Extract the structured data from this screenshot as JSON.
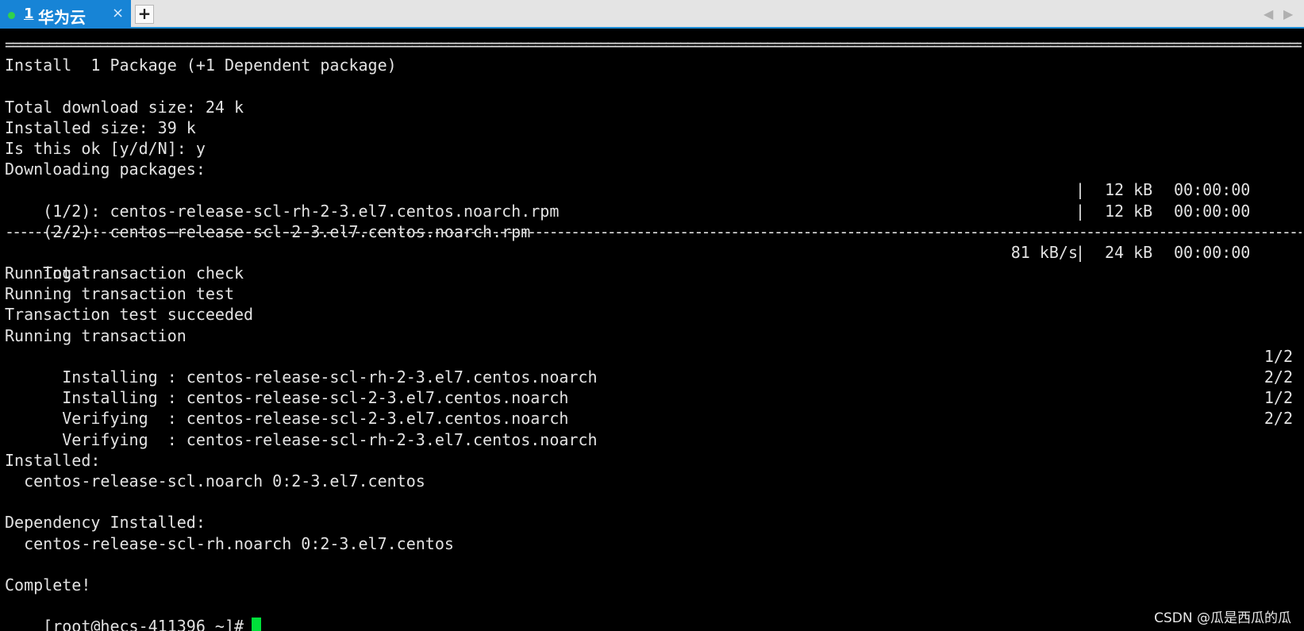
{
  "tab": {
    "number": "1",
    "title": "华为云",
    "close": "×",
    "status_color": "#31d14d",
    "accent_color": "#1784d6"
  },
  "tabbar": {
    "new_tab": "+",
    "nav_left": "◀",
    "nav_right": "▶"
  },
  "terminal": {
    "rule_eq": "============================================================================================================================================================================================================",
    "rule_dash": "--------------------------------------------------------------------------------------------------------------------------------------------------------------------------------------------------------------",
    "install_summary": "Install  1 Package (+1 Dependent package)",
    "total_download": "Total download size: 24 k",
    "installed_size": "Installed size: 39 k",
    "confirm": "Is this ok [y/d/N]: y",
    "downloading": "Downloading packages:",
    "downloads": [
      {
        "name": "(1/2): centos-release-scl-rh-2-3.el7.centos.noarch.rpm",
        "pipe": "|",
        "size": "12 kB",
        "time": "00:00:00"
      },
      {
        "name": "(2/2): centos-release-scl-2-3.el7.centos.noarch.rpm",
        "pipe": "|",
        "size": "12 kB",
        "time": "00:00:00"
      }
    ],
    "total": {
      "label": "Total",
      "rate": "81 kB/s",
      "pipe": "|",
      "size": "24 kB",
      "time": "00:00:00"
    },
    "check": "Running transaction check",
    "test": "Running transaction test",
    "succeeded": "Transaction test succeeded",
    "running": "Running transaction",
    "steps": [
      {
        "text": "  Installing : centos-release-scl-rh-2-3.el7.centos.noarch",
        "count": "1/2"
      },
      {
        "text": "  Installing : centos-release-scl-2-3.el7.centos.noarch",
        "count": "2/2"
      },
      {
        "text": "  Verifying  : centos-release-scl-2-3.el7.centos.noarch",
        "count": "1/2"
      },
      {
        "text": "  Verifying  : centos-release-scl-rh-2-3.el7.centos.noarch",
        "count": "2/2"
      }
    ],
    "installed_header": "Installed:",
    "installed_pkg": "  centos-release-scl.noarch 0:2-3.el7.centos",
    "dep_header": "Dependency Installed:",
    "dep_pkg": "  centos-release-scl-rh.noarch 0:2-3.el7.centos",
    "complete": "Complete!",
    "prompt": "[root@hecs-411396 ~]#",
    "cursor_color": "#00e03a"
  },
  "watermark": "CSDN @瓜是西瓜的瓜"
}
